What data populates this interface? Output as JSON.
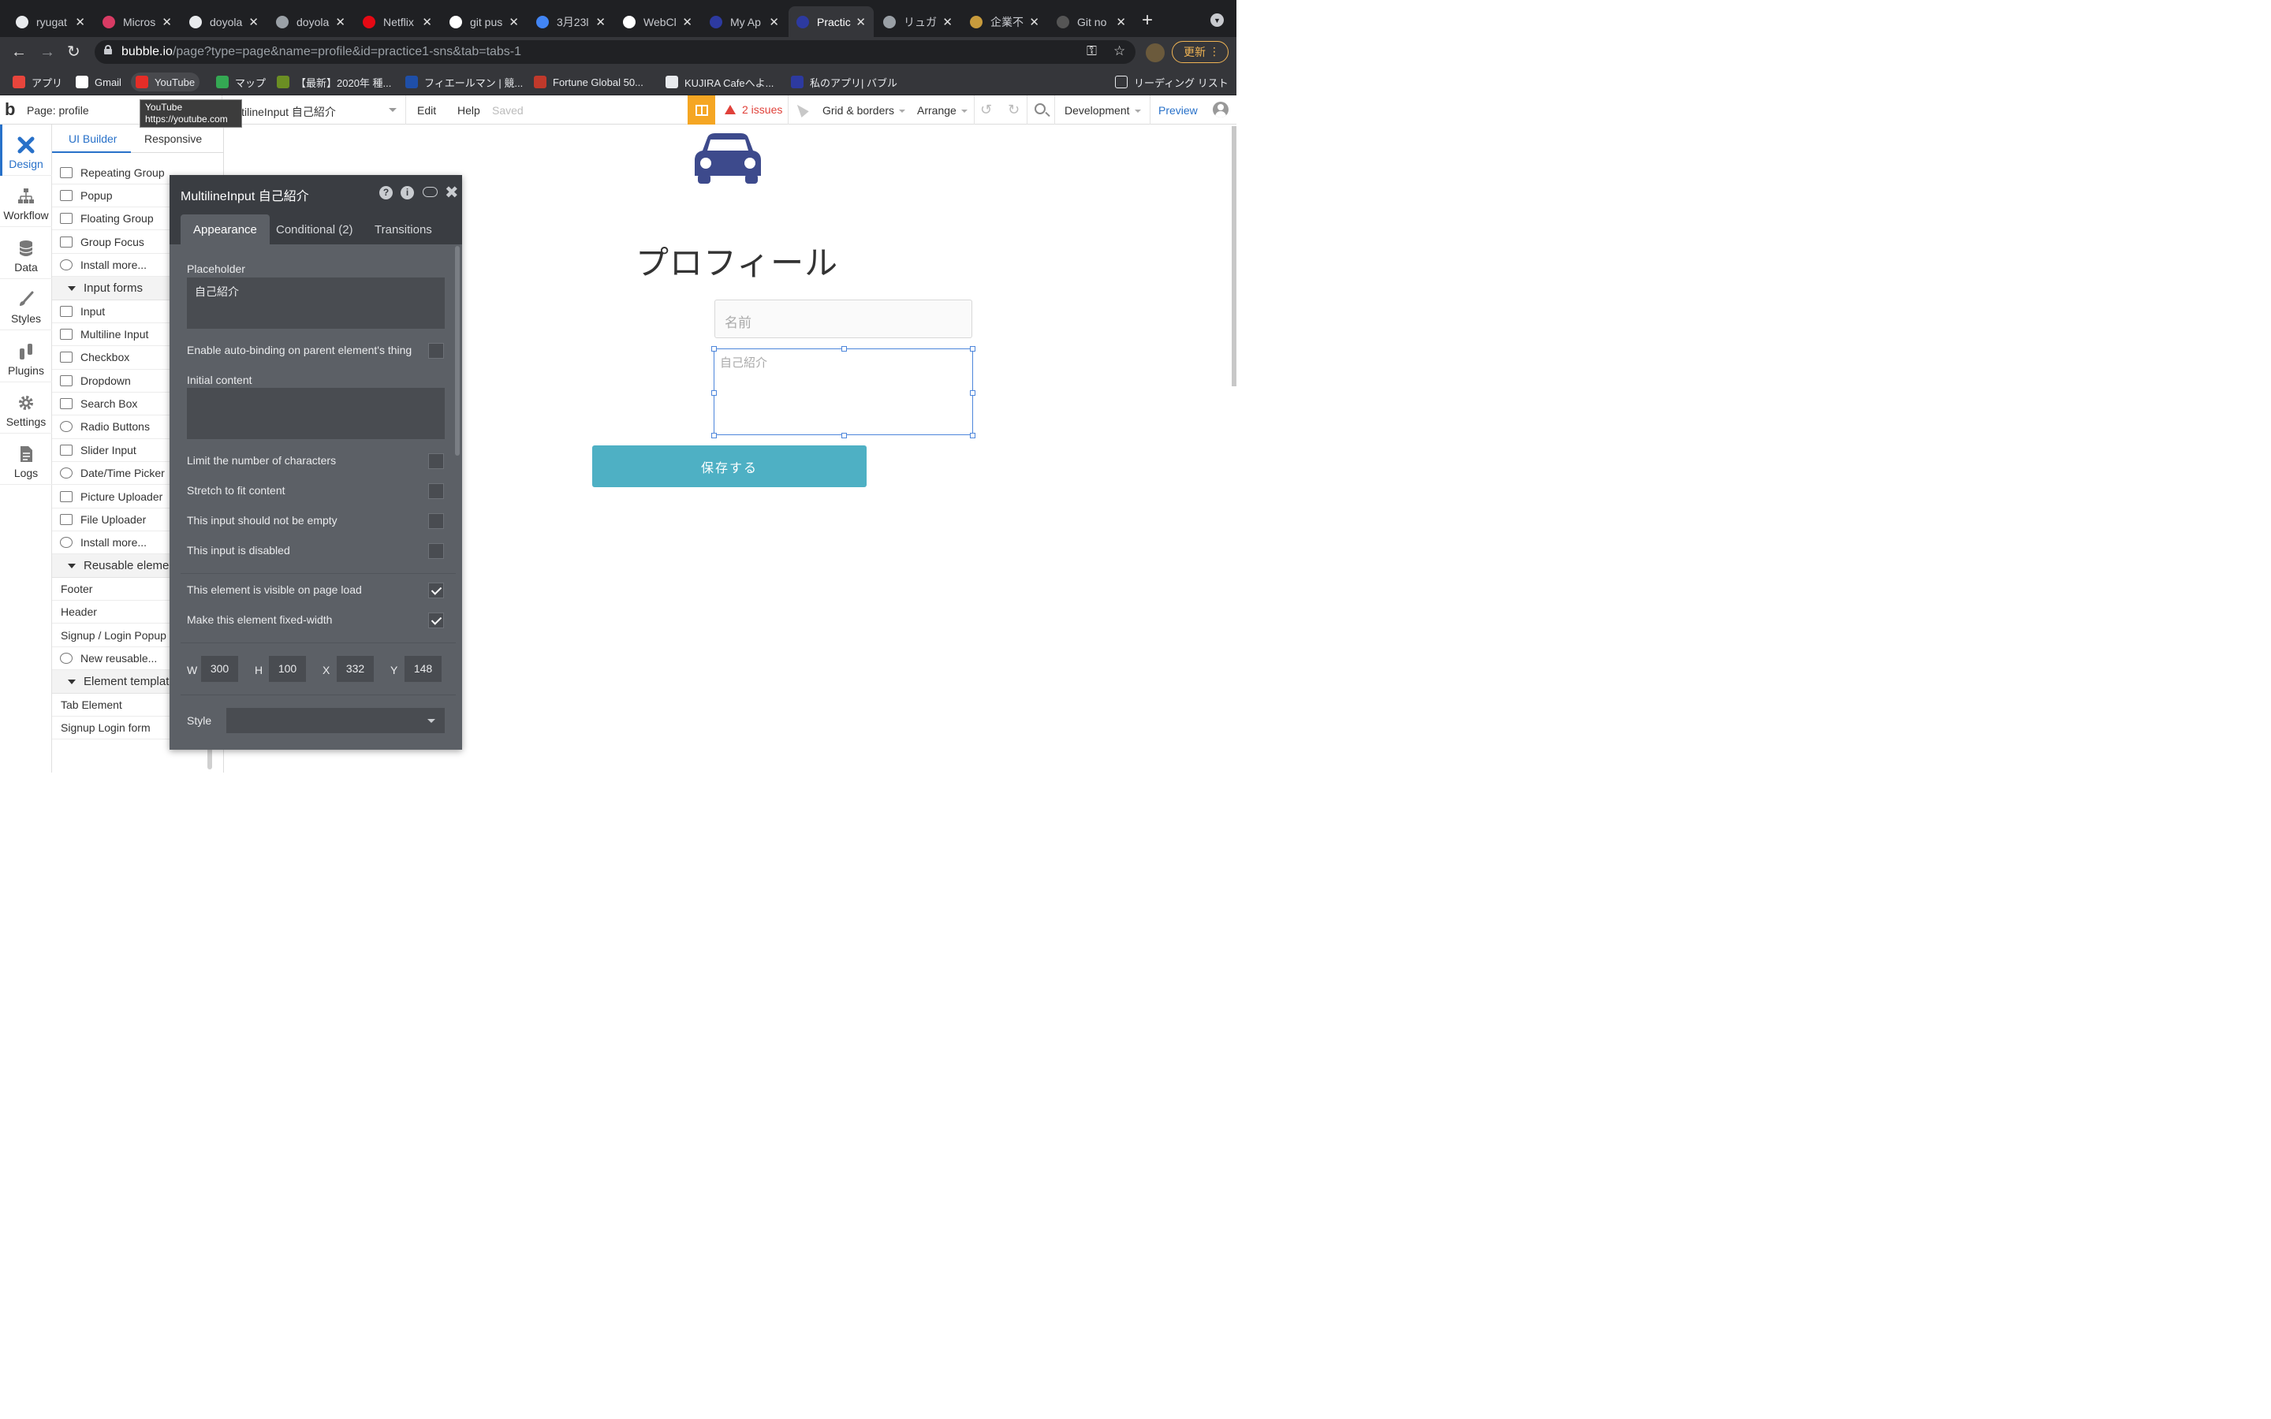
{
  "browser": {
    "tabs": [
      {
        "title": "ryugat",
        "color": "#e8eaed"
      },
      {
        "title": "Micros",
        "color": "#d83b64"
      },
      {
        "title": "doyola",
        "color": "#e8eaed"
      },
      {
        "title": "doyola",
        "color": "#9aa0a6"
      },
      {
        "title": "Netflix",
        "color": "#e50914"
      },
      {
        "title": "git pus",
        "color": "#ffffff"
      },
      {
        "title": "3月23l",
        "color": "#4285f4"
      },
      {
        "title": "WebCl",
        "color": "#ffffff"
      },
      {
        "title": "My Ap",
        "color": "#2d3aa0"
      },
      {
        "title": "Practic",
        "color": "#2d3aa0",
        "active": true
      },
      {
        "title": "リュガ",
        "color": "#9aa0a6"
      },
      {
        "title": "企業不",
        "color": "#c89b3c"
      },
      {
        "title": "Git no",
        "color": "#555555"
      }
    ],
    "url_host": "bubble.io",
    "url_path": "/page?type=page&name=profile&id=practice1-sns&tab=tabs-1",
    "update_label": "更新",
    "bookmarks": [
      {
        "label": "アプリ",
        "color": "#e8453c"
      },
      {
        "label": "Gmail",
        "color": "#ffffff"
      },
      {
        "label": "YouTube",
        "color": "#e52d27"
      },
      {
        "label": "マップ",
        "color": "#34a853"
      },
      {
        "label": "【最新】2020年 種...",
        "color": "#6b8e23"
      },
      {
        "label": "フィエールマン | 競...",
        "color": "#1f4fa8"
      },
      {
        "label": "Fortune Global 50...",
        "color": "#c0392b"
      },
      {
        "label": "KUJIRA Cafeへよ...",
        "color": "#e8eaed"
      },
      {
        "label": "私のアプリ| バブル",
        "color": "#2d3aa0"
      }
    ],
    "reading_list": "リーディング リスト",
    "tooltip_title": "YouTube",
    "tooltip_url": "https://youtube.com"
  },
  "editor": {
    "page_label": "Page: profile",
    "element_selector": "ltilineInput 自己紹介",
    "menu": {
      "edit": "Edit",
      "help": "Help",
      "saved": "Saved"
    },
    "issues": "2 issues",
    "grid": "Grid & borders",
    "arrange": "Arrange",
    "env": "Development",
    "preview": "Preview"
  },
  "rail": [
    {
      "label": "Design",
      "icon": "design-icon"
    },
    {
      "label": "Workflow",
      "icon": "workflow-icon"
    },
    {
      "label": "Data",
      "icon": "database-icon"
    },
    {
      "label": "Styles",
      "icon": "brush-icon"
    },
    {
      "label": "Plugins",
      "icon": "plug-icon"
    },
    {
      "label": "Settings",
      "icon": "gear-icon"
    },
    {
      "label": "Logs",
      "icon": "document-icon"
    }
  ],
  "palette": {
    "tab_ui": "UI Builder",
    "tab_responsive": "Responsive",
    "items": [
      {
        "label": "Repeating Group"
      },
      {
        "label": "Popup"
      },
      {
        "label": "Floating Group"
      },
      {
        "label": "Group Focus"
      },
      {
        "label": "Install more..."
      },
      {
        "label": "Input forms",
        "header": true
      },
      {
        "label": "Input"
      },
      {
        "label": "Multiline Input"
      },
      {
        "label": "Checkbox"
      },
      {
        "label": "Dropdown"
      },
      {
        "label": "Search Box"
      },
      {
        "label": "Radio Buttons"
      },
      {
        "label": "Slider Input"
      },
      {
        "label": "Date/Time Picker"
      },
      {
        "label": "Picture Uploader"
      },
      {
        "label": "File Uploader"
      },
      {
        "label": "Install more..."
      },
      {
        "label": "Reusable elemen",
        "header": true
      },
      {
        "label": "Footer",
        "plain": true
      },
      {
        "label": "Header",
        "plain": true
      },
      {
        "label": "Signup / Login Popup",
        "plain": true
      },
      {
        "label": "New reusable..."
      },
      {
        "label": "Element templat",
        "header": true
      },
      {
        "label": "Tab Element",
        "plain": true
      },
      {
        "label": "Signup Login form",
        "plain": true
      }
    ]
  },
  "canvas": {
    "title": "プロフィール",
    "name_placeholder": "名前",
    "bio_placeholder": "自己紹介",
    "save_label": "保存する",
    "car_color": "#3d4a8c",
    "button_color": "#4eb0c4"
  },
  "property_editor": {
    "title": "MultilineInput 自己紹介",
    "tabs": [
      "Appearance",
      "Conditional (2)",
      "Transitions"
    ],
    "placeholder_label": "Placeholder",
    "placeholder_value": "自己紹介",
    "autobinding": "Enable auto-binding on parent element's thing",
    "initial_content_label": "Initial content",
    "initial_content_value": "",
    "limit_chars": "Limit the number of characters",
    "stretch": "Stretch to fit content",
    "not_empty": "This input should not be empty",
    "disabled": "This input is disabled",
    "visible_on_load": "This element is visible on page load",
    "fixed_width": "Make this element fixed-width",
    "dims": {
      "w_label": "W",
      "w": "300",
      "h_label": "H",
      "h": "100",
      "x_label": "X",
      "x": "332",
      "y_label": "Y",
      "y": "148"
    },
    "style_label": "Style"
  }
}
